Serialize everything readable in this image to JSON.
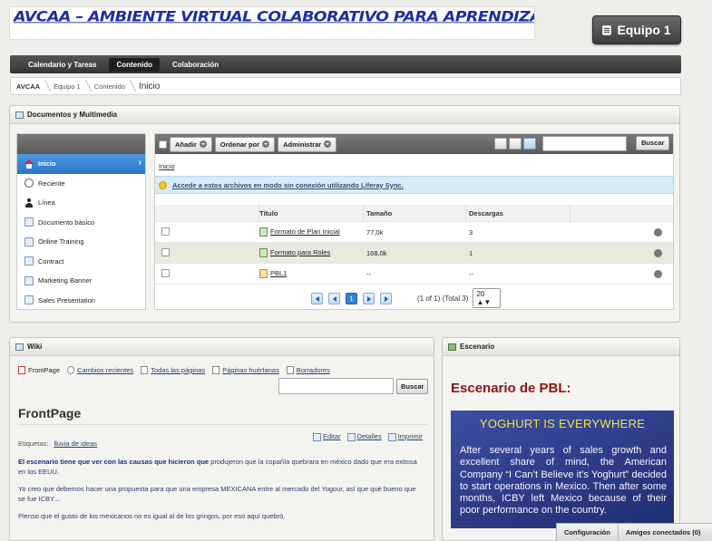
{
  "banner": {
    "title": "AVCAA – AMBIENTE VIRTUAL COLABORATIVO PARA APRENDIZAJE ACTIVO"
  },
  "site_button": {
    "label": "Equipo 1"
  },
  "nav": {
    "tabs": [
      {
        "label": "Calendario y Tareas",
        "selected": false
      },
      {
        "label": "Contenido",
        "selected": true
      },
      {
        "label": "Colaboración",
        "selected": false
      }
    ]
  },
  "breadcrumb": [
    "AVCAA",
    "Equipo 1",
    "Contenido",
    "Inicio"
  ],
  "docs": {
    "title": "Documentos y Multimedia",
    "sidebar": [
      {
        "label": "Inicio",
        "icon": "home-icon",
        "selected": true
      },
      {
        "label": "Reciente",
        "icon": "clock-icon"
      },
      {
        "label": "Línea",
        "icon": "user-icon"
      },
      {
        "label": "Documento básico",
        "icon": "document-type-icon"
      },
      {
        "label": "Online Training",
        "icon": "document-type-icon"
      },
      {
        "label": "Contract",
        "icon": "document-type-icon"
      },
      {
        "label": "Marketing Banner",
        "icon": "document-type-icon"
      },
      {
        "label": "Sales Presentation",
        "icon": "document-type-icon"
      }
    ],
    "toolbar": {
      "add": "Añadir",
      "order": "Ordenar por",
      "manage": "Administrar",
      "search_button": "Buscar",
      "search_value": ""
    },
    "folder_link": "Inicio",
    "sync_message": "Accede a estos archivos en modo sin conexión utilizando Liferay Sync.",
    "columns": [
      "",
      "Título",
      "Tamaño",
      "Descargas",
      ""
    ],
    "rows": [
      {
        "title": "Formato de Plan Inicial",
        "size": "77,0k",
        "downloads": "3"
      },
      {
        "title": "Formato para Roles",
        "size": "168,0k",
        "downloads": "1"
      },
      {
        "title": "PBL1",
        "size": "--",
        "downloads": "--"
      }
    ],
    "pager": {
      "current": "1",
      "info": "(1 of 1) (Total 3)",
      "per_page": "20 ▲▼"
    }
  },
  "wiki": {
    "title": "Wiki",
    "nav": [
      "FrontPage",
      "Cambios recientes",
      "Todas las páginas",
      "Páginas huérfanas",
      "Borradores"
    ],
    "search_button": "Buscar",
    "page_title": "FrontPage",
    "actions": [
      "Editar",
      "Detalles",
      "Imprimir"
    ],
    "tags_label": "Etiquetas:",
    "tag": "lluvia de ideas",
    "p1_bold": "El escenario tiene que ver con las causas que hicieron que",
    "p1_rest": " produjeron que la copañía quebrara en méxico dado que era exitosa en los EEUU.",
    "p2": "Yo creo que debemos hacer una propuesta para que una empresa MEXICANA entre al mercado del Yogour, así que qué bueno que se fue ICBY...",
    "p3": "Pienso que el gusto de los mexicanos no es igual al de los gringos, por eso aquí quebró."
  },
  "scenario": {
    "title": "Escenario",
    "heading": "Escenario de PBL:",
    "image_title": "YOGHURT IS EVERYWHERE",
    "image_text": "After several years of sales growth and excellent share of mind, the American Company “I Can’t Believe it’s Yoghurt” decided to start operations in Mexico. Then after some months, ICBY left Mexico because of their poor performance on the country."
  },
  "footer": {
    "config": "Configuración",
    "friends": "Amigos conectados (0)"
  }
}
